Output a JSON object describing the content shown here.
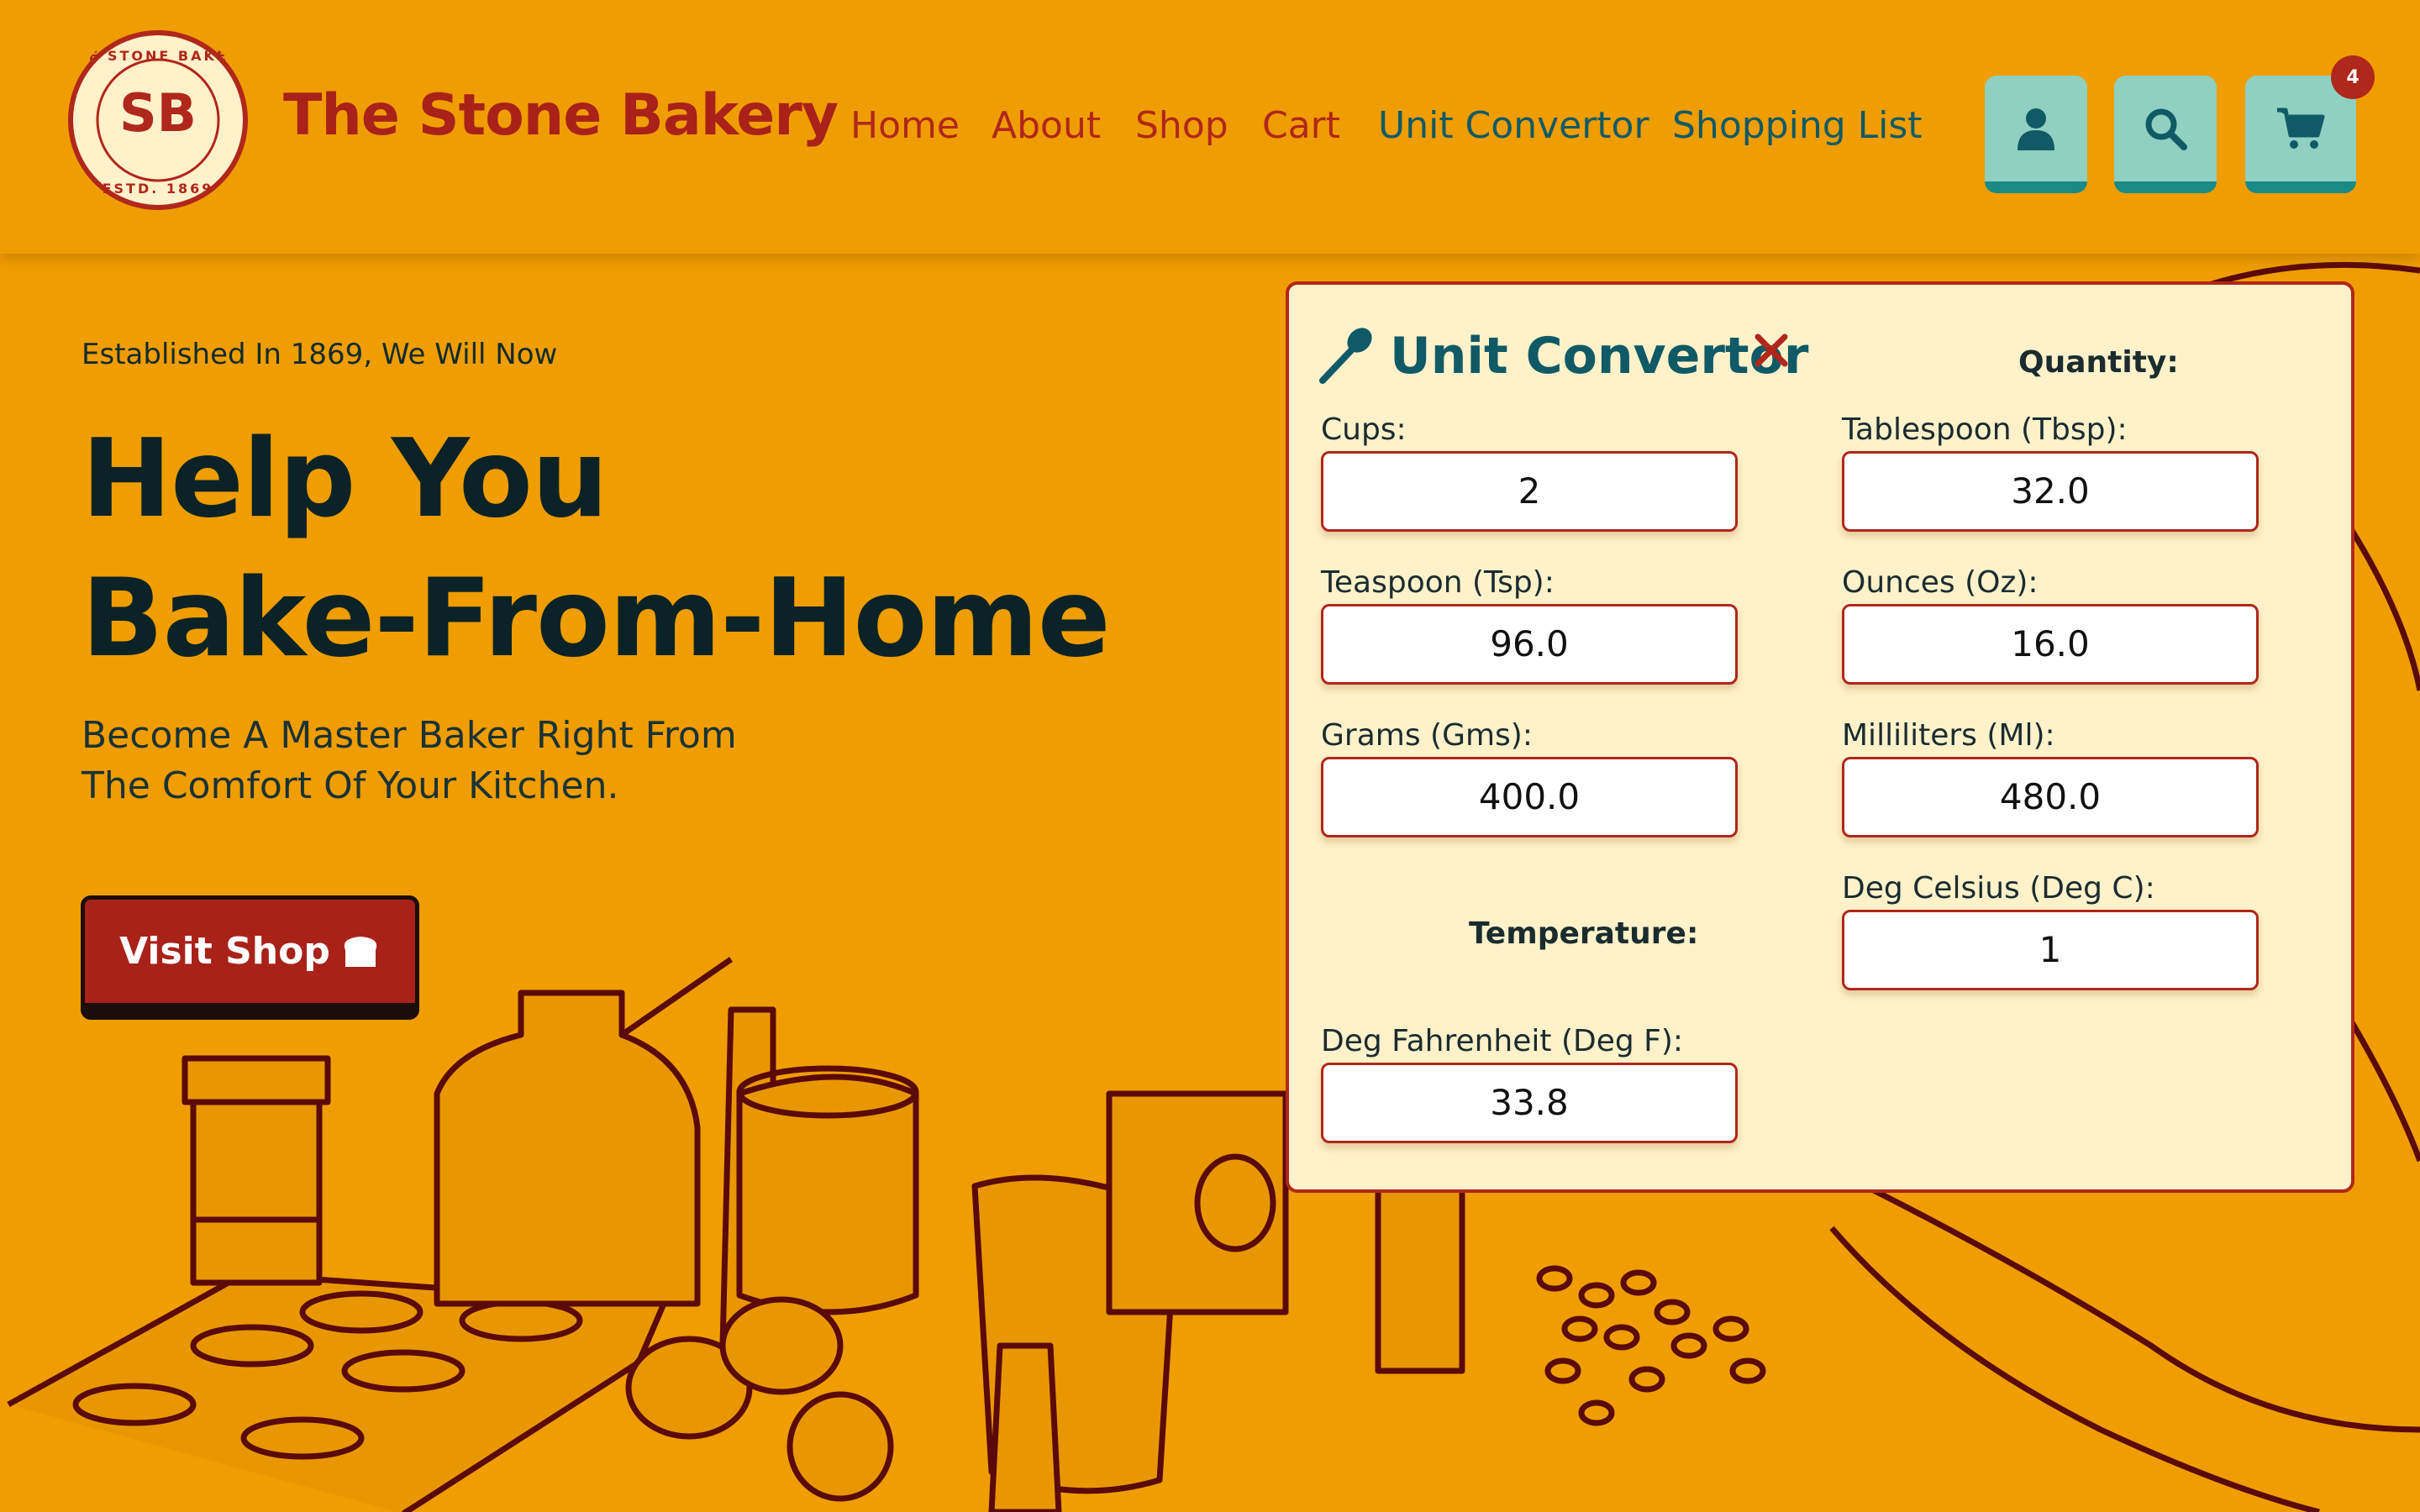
{
  "brand": {
    "name": "The Stone Bakery",
    "logo_top": "THE STONE BAKERY",
    "logo_bottom": "ESTD. 1869",
    "logo_initials": "SB"
  },
  "nav": {
    "items": [
      {
        "label": "Home"
      },
      {
        "label": "About"
      },
      {
        "label": "Shop"
      },
      {
        "label": "Cart"
      },
      {
        "label": "Unit Convertor"
      },
      {
        "label": "Shopping List"
      }
    ]
  },
  "header_icons": {
    "account": "user-icon",
    "search": "search-icon",
    "cart": "cart-icon",
    "cart_count": "4"
  },
  "hero": {
    "tagline": "Established In 1869, We Will Now",
    "headline_line1": "Help You",
    "headline_line2": "Bake-From-Home",
    "sub_line1": "Become A Master Baker Right From",
    "sub_line2": "The Comfort Of Your Kitchen.",
    "cta_label": "Visit Shop",
    "cta_icon": "bread-icon"
  },
  "convertor": {
    "title": "Unit Convertor",
    "quantity_heading": "Quantity:",
    "temperature_heading": "Temperature:",
    "fields": {
      "cups": {
        "label": "Cups:",
        "value": "2"
      },
      "tbsp": {
        "label": "Tablespoon (Tbsp):",
        "value": "32.0"
      },
      "tsp": {
        "label": "Teaspoon (Tsp):",
        "value": "96.0"
      },
      "oz": {
        "label": "Ounces (Oz):",
        "value": "16.0"
      },
      "gms": {
        "label": "Grams (Gms):",
        "value": "400.0"
      },
      "ml": {
        "label": "Milliliters (Ml):",
        "value": "480.0"
      },
      "degc": {
        "label": "Deg Celsius (Deg C):",
        "value": "1"
      },
      "degf": {
        "label": "Deg Fahrenheit (Deg F):",
        "value": "33.8"
      }
    }
  },
  "colors": {
    "background": "#EF9D00",
    "brand_red": "#A8221A",
    "teal": "#0F5A66",
    "icon_button": "#8FD0C0",
    "panel_bg": "#FFF1C9",
    "line_art": "#5B0A0A"
  }
}
